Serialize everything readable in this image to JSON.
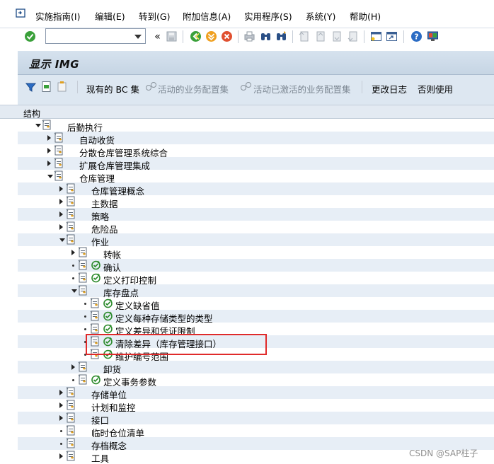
{
  "menubar": {
    "items": [
      "实施指南(I)",
      "编辑(E)",
      "转到(G)",
      "附加信息(A)",
      "实用程序(S)",
      "系统(Y)",
      "帮助(H)"
    ]
  },
  "toolbar": {
    "command_value": "",
    "icons": [
      "enter-icon",
      "back-icon",
      "exit-icon",
      "cancel-icon",
      "print-icon",
      "find-icon",
      "find-next-icon",
      "first-page-icon",
      "prev-page-icon",
      "next-page-icon",
      "last-page-icon",
      "new-session-icon",
      "shortcut-icon",
      "help-icon",
      "customize-layout-icon"
    ]
  },
  "screen": {
    "title": "显示 IMG"
  },
  "app_toolbar": {
    "existing_bc_sets": "现有的 BC 集",
    "activated_bc_sets": "活动的业务配置集",
    "activated_bc_sets_activity": "活动已激活的业务配置集",
    "change_log": "更改日志",
    "release_notes": "否则使用"
  },
  "tree": {
    "header": "结构",
    "rows": [
      {
        "label": "后勤执行",
        "level": 1,
        "exp": "open",
        "act": false
      },
      {
        "label": "自动收货",
        "level": 2,
        "exp": "closed",
        "act": false
      },
      {
        "label": "分散仓库管理系统综合",
        "level": 2,
        "exp": "closed",
        "act": false
      },
      {
        "label": "扩展仓库管理集成",
        "level": 2,
        "exp": "closed",
        "act": false
      },
      {
        "label": "仓库管理",
        "level": 2,
        "exp": "open",
        "act": false
      },
      {
        "label": "仓库管理概念",
        "level": 3,
        "exp": "closed",
        "act": false
      },
      {
        "label": "主数据",
        "level": 3,
        "exp": "closed",
        "act": false
      },
      {
        "label": "策略",
        "level": 3,
        "exp": "closed",
        "act": false
      },
      {
        "label": "危险品",
        "level": 3,
        "exp": "closed",
        "act": false
      },
      {
        "label": "作业",
        "level": 3,
        "exp": "open",
        "act": false
      },
      {
        "label": "转帐",
        "level": 4,
        "exp": "closed",
        "act": false
      },
      {
        "label": "确认",
        "level": 4,
        "exp": "leaf",
        "act": true
      },
      {
        "label": "定义打印控制",
        "level": 4,
        "exp": "leaf",
        "act": true
      },
      {
        "label": "库存盘点",
        "level": 4,
        "exp": "open",
        "act": false
      },
      {
        "label": "定义缺省值",
        "level": 5,
        "exp": "leaf",
        "act": true
      },
      {
        "label": "定义每种存储类型的类型",
        "level": 5,
        "exp": "leaf",
        "act": true
      },
      {
        "label": "定义差异和凭证限制",
        "level": 5,
        "exp": "leaf",
        "act": true
      },
      {
        "label": "清除差异（库存管理接口）",
        "level": 5,
        "exp": "leaf",
        "act": true
      },
      {
        "label": "维护编号范围",
        "level": 5,
        "exp": "leaf",
        "act": true
      },
      {
        "label": "卸货",
        "level": 4,
        "exp": "closed",
        "act": false
      },
      {
        "label": "定义事务参数",
        "level": 4,
        "exp": "leaf",
        "act": true
      },
      {
        "label": "存储单位",
        "level": 3,
        "exp": "closed",
        "act": false
      },
      {
        "label": "计划和监控",
        "level": 3,
        "exp": "closed",
        "act": false
      },
      {
        "label": "接口",
        "level": 3,
        "exp": "closed",
        "act": false
      },
      {
        "label": "临时仓位清单",
        "level": 3,
        "exp": "leaf",
        "act": false
      },
      {
        "label": "存档概念",
        "level": 3,
        "exp": "leaf",
        "act": false
      },
      {
        "label": "工具",
        "level": 3,
        "exp": "closed",
        "act": false
      }
    ]
  },
  "watermark": "CSDN @SAP柱子"
}
